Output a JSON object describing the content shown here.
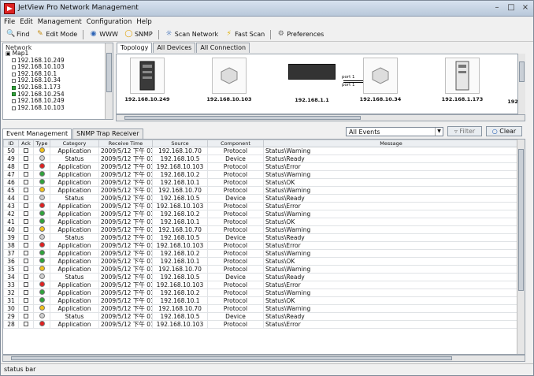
{
  "window": {
    "title": "JetView Pro Network Management",
    "controls": [
      "–",
      "□",
      "×"
    ]
  },
  "menu": [
    "File",
    "Edit",
    "Management",
    "Configuration",
    "Help"
  ],
  "toolbar": {
    "find": "Find",
    "edit_mode": "Edit Mode",
    "www": "WWW",
    "snmp": "SNMP",
    "scan_network": "Scan Network",
    "fast_scan": "Fast Scan",
    "preferences": "Preferences"
  },
  "network": {
    "label": "Network",
    "root": "Map1",
    "items": [
      {
        "ip": "192.168.10.249",
        "status": "gray"
      },
      {
        "ip": "192.168.10.103",
        "status": "gray"
      },
      {
        "ip": "192.168.10.1",
        "status": "gray"
      },
      {
        "ip": "192.168.10.34",
        "status": "gray"
      },
      {
        "ip": "192.168.1.173",
        "status": "green"
      },
      {
        "ip": "192.168.10.254",
        "status": "green"
      },
      {
        "ip": "192.168.10.249",
        "status": "gray"
      },
      {
        "ip": "192.168.10.103",
        "status": "gray"
      }
    ]
  },
  "topology": {
    "tabs": [
      "Topology",
      "All Devices",
      "All Connection"
    ],
    "devices": [
      "192.168.10.249",
      "192.168.10.103",
      "192.168.1.1",
      "192.168.10.34",
      "192.168.1.173",
      "192"
    ],
    "port_labels": [
      "port 1",
      "port 1"
    ]
  },
  "events": {
    "tabs": [
      "Event Management",
      "SNMP Trap Receiver"
    ],
    "filter_value": "All Events",
    "filter_button": "Filter",
    "clear_button": "Clear",
    "columns": [
      "ID",
      "Ack",
      "Type",
      "Category",
      "Receive Time",
      "Source",
      "Component",
      "Message"
    ],
    "rows": [
      {
        "id": "50",
        "type": "yellow",
        "category": "Application",
        "time": "2009/5/12 下午 01:",
        "source": "192.168.10.70",
        "component": "Protocol",
        "message": "Status\\Warning"
      },
      {
        "id": "49",
        "type": "gray",
        "category": "Status",
        "time": "2009/5/12 下午 01:",
        "source": "192.168.10.5",
        "component": "Device",
        "message": "Status\\Ready"
      },
      {
        "id": "48",
        "type": "red",
        "category": "Application",
        "time": "2009/5/12 下午 01:",
        "source": "192.168.10.103",
        "component": "Protocol",
        "message": "Status\\Error"
      },
      {
        "id": "47",
        "type": "green",
        "category": "Application",
        "time": "2009/5/12 下午 01:",
        "source": "192.168.10.2",
        "component": "Protocol",
        "message": "Status\\Warning"
      },
      {
        "id": "46",
        "type": "green",
        "category": "Application",
        "time": "2009/5/12 下午 01:",
        "source": "192.168.10.1",
        "component": "Protocol",
        "message": "Status\\OK"
      },
      {
        "id": "45",
        "type": "yellow",
        "category": "Application",
        "time": "2009/5/12 下午 01:",
        "source": "192.168.10.70",
        "component": "Protocol",
        "message": "Status\\Warning"
      },
      {
        "id": "44",
        "type": "gray",
        "category": "Status",
        "time": "2009/5/12 下午 01:",
        "source": "192.168.10.5",
        "component": "Device",
        "message": "Status\\Ready"
      },
      {
        "id": "43",
        "type": "red",
        "category": "Application",
        "time": "2009/5/12 下午 01:",
        "source": "192.168.10.103",
        "component": "Protocol",
        "message": "Status\\Error"
      },
      {
        "id": "42",
        "type": "green",
        "category": "Application",
        "time": "2009/5/12 下午 01:",
        "source": "192.168.10.2",
        "component": "Protocol",
        "message": "Status\\Warning"
      },
      {
        "id": "41",
        "type": "green",
        "category": "Application",
        "time": "2009/5/12 下午 01:",
        "source": "192.168.10.1",
        "component": "Protocol",
        "message": "Status\\OK"
      },
      {
        "id": "40",
        "type": "yellow",
        "category": "Application",
        "time": "2009/5/12 下午 01:",
        "source": "192.168.10.70",
        "component": "Protocol",
        "message": "Status\\Warning"
      },
      {
        "id": "39",
        "type": "gray",
        "category": "Status",
        "time": "2009/5/12 下午 01:",
        "source": "192.168.10.5",
        "component": "Device",
        "message": "Status\\Ready"
      },
      {
        "id": "38",
        "type": "red",
        "category": "Application",
        "time": "2009/5/12 下午 01:",
        "source": "192.168.10.103",
        "component": "Protocol",
        "message": "Status\\Error"
      },
      {
        "id": "37",
        "type": "green",
        "category": "Application",
        "time": "2009/5/12 下午 01:",
        "source": "192.168.10.2",
        "component": "Protocol",
        "message": "Status\\Warning"
      },
      {
        "id": "36",
        "type": "green",
        "category": "Application",
        "time": "2009/5/12 下午 01:",
        "source": "192.168.10.1",
        "component": "Protocol",
        "message": "Status\\OK"
      },
      {
        "id": "35",
        "type": "yellow",
        "category": "Application",
        "time": "2009/5/12 下午 01:",
        "source": "192.168.10.70",
        "component": "Protocol",
        "message": "Status\\Warning"
      },
      {
        "id": "34",
        "type": "gray",
        "category": "Status",
        "time": "2009/5/12 下午 01:",
        "source": "192.168.10.5",
        "component": "Device",
        "message": "Status\\Ready"
      },
      {
        "id": "33",
        "type": "red",
        "category": "Application",
        "time": "2009/5/12 下午 01:",
        "source": "192.168.10.103",
        "component": "Protocol",
        "message": "Status\\Error"
      },
      {
        "id": "32",
        "type": "green",
        "category": "Application",
        "time": "2009/5/12 下午 01:",
        "source": "192.168.10.2",
        "component": "Protocol",
        "message": "Status\\Warning"
      },
      {
        "id": "31",
        "type": "green",
        "category": "Application",
        "time": "2009/5/12 下午 01:",
        "source": "192.168.10.1",
        "component": "Protocol",
        "message": "Status\\OK"
      },
      {
        "id": "30",
        "type": "yellow",
        "category": "Application",
        "time": "2009/5/12 下午 01:",
        "source": "192.168.10.70",
        "component": "Protocol",
        "message": "Status\\Warning"
      },
      {
        "id": "29",
        "type": "gray",
        "category": "Status",
        "time": "2009/5/12 下午 01:",
        "source": "192.168.10.5",
        "component": "Device",
        "message": "Status\\Ready"
      },
      {
        "id": "28",
        "type": "red",
        "category": "Application",
        "time": "2009/5/12 下午 01:",
        "source": "192.168.10.103",
        "component": "Protocol",
        "message": "Status\\Error"
      }
    ]
  },
  "status_bar": "status bar"
}
